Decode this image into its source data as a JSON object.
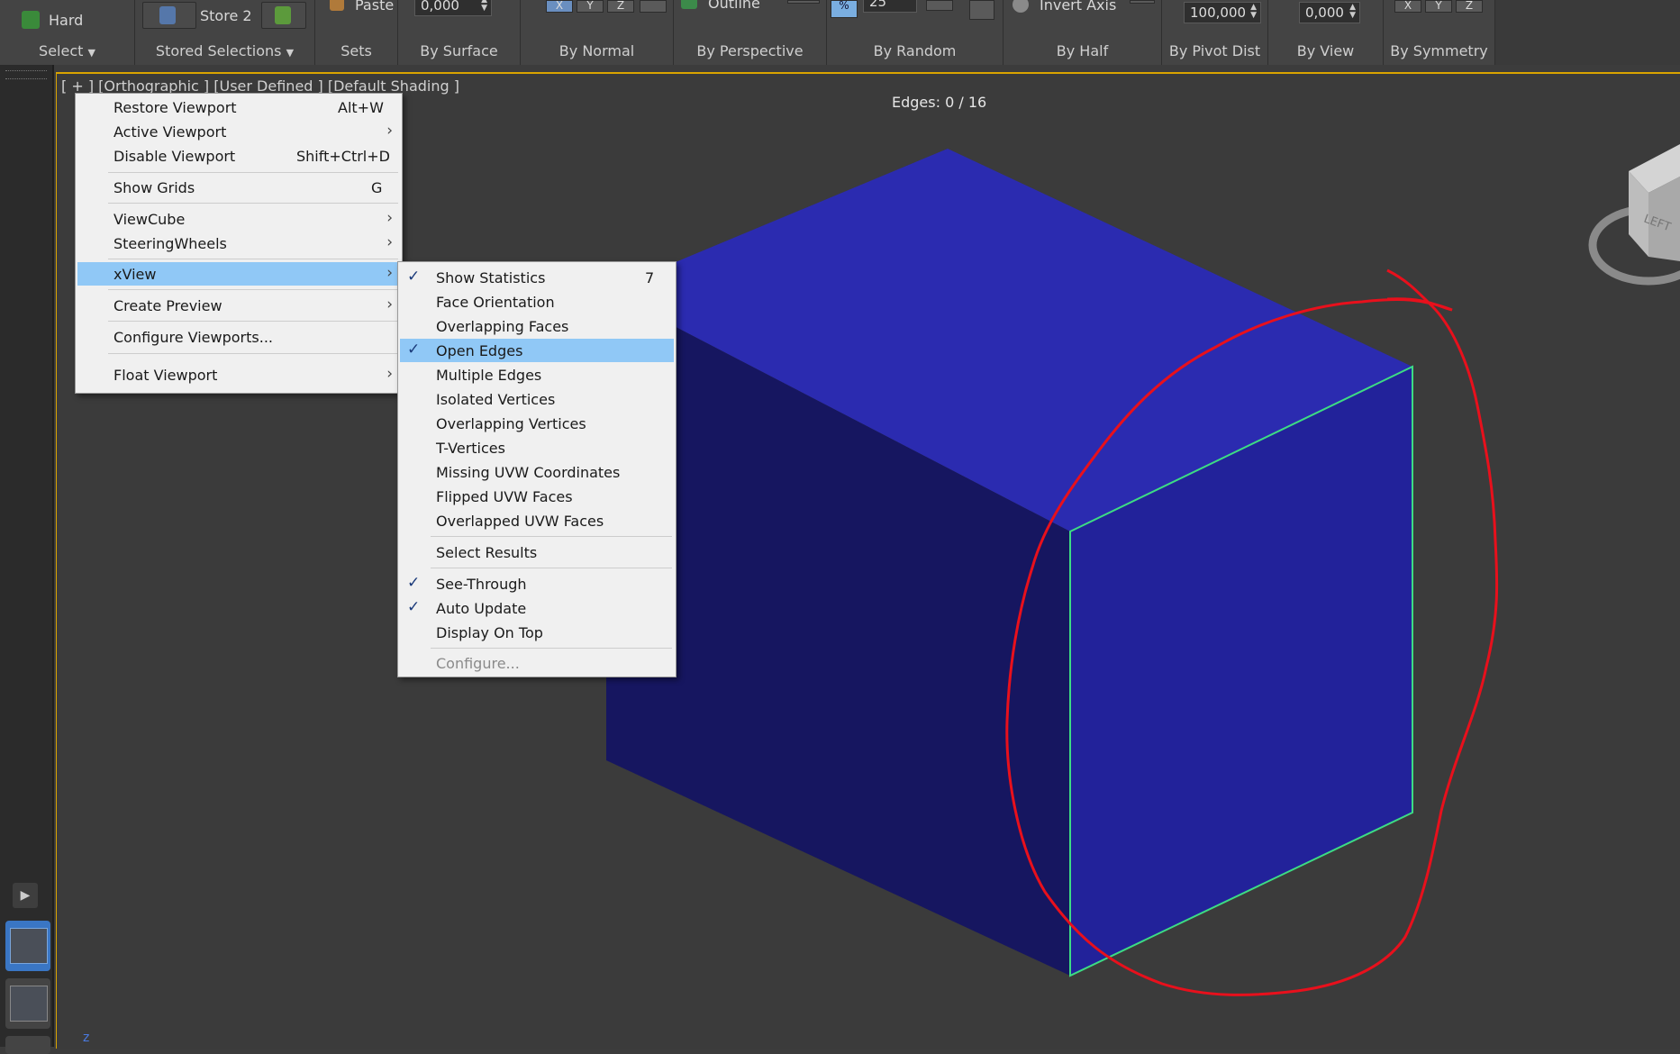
{
  "ribbon": {
    "select_group": {
      "preset": "Hard",
      "label": "Select"
    },
    "stored_group": {
      "store": "Store 2",
      "label": "Stored Selections"
    },
    "sets_group": {
      "paste": "Paste",
      "label": "Sets"
    },
    "surface_group": {
      "value": "0,000",
      "label": "By Surface"
    },
    "normal_group": {
      "label": "By Normal",
      "axes": [
        "X",
        "Y",
        "Z"
      ]
    },
    "perspective_group": {
      "outline": "Outline",
      "label": "By Perspective"
    },
    "random_group": {
      "value": "25",
      "label": "By Random"
    },
    "half_group": {
      "invert_axis": "Invert Axis",
      "label": "By Half"
    },
    "pivot_group": {
      "value": "100,000",
      "label": "By Pivot Dist"
    },
    "view_group": {
      "value": "0,000",
      "label": "By View"
    },
    "symmetry_group": {
      "label": "By Symmetry",
      "axes": [
        "X",
        "Y",
        "Z"
      ]
    }
  },
  "viewport": {
    "label": "[ + ] [Orthographic ] [User Defined ] [Default Shading ]",
    "edges_stat": "Edges: 0 / 16",
    "viewcube_face": "LEFT",
    "axis_label": "z",
    "face_colors": {
      "top": "#2b2bb0",
      "left": "#161660",
      "front": "#22229a",
      "open_edge": "#3ddc84"
    },
    "annotation_color": "#e8101c"
  },
  "context_menu": {
    "items": [
      {
        "label": "Restore Viewport",
        "shortcut": "Alt+W"
      },
      {
        "label": "Active Viewport",
        "submenu": true
      },
      {
        "label": "Disable Viewport",
        "shortcut": "Shift+Ctrl+D"
      },
      {
        "label": "Show Grids",
        "shortcut": "G"
      },
      {
        "label": "ViewCube",
        "submenu": true
      },
      {
        "label": "SteeringWheels",
        "submenu": true
      },
      {
        "label": "xView",
        "submenu": true,
        "highlighted": true
      },
      {
        "label": "Create Preview",
        "submenu": true
      },
      {
        "label": "Configure Viewports..."
      },
      {
        "label": "Float Viewport",
        "submenu": true
      }
    ]
  },
  "xview_menu": {
    "items": [
      {
        "label": "Show Statistics",
        "checked": true,
        "shortcut": "7"
      },
      {
        "label": "Face Orientation"
      },
      {
        "label": "Overlapping Faces"
      },
      {
        "label": "Open Edges",
        "checked": true,
        "highlighted": true
      },
      {
        "label": "Multiple Edges"
      },
      {
        "label": "Isolated Vertices"
      },
      {
        "label": "Overlapping Vertices"
      },
      {
        "label": "T-Vertices"
      },
      {
        "label": "Missing UVW Coordinates"
      },
      {
        "label": "Flipped UVW Faces"
      },
      {
        "label": "Overlapped UVW Faces"
      },
      {
        "label": "Select Results"
      },
      {
        "label": "See-Through",
        "checked": true
      },
      {
        "label": "Auto Update",
        "checked": true
      },
      {
        "label": "Display On Top"
      },
      {
        "label": "Configure...",
        "disabled": true
      }
    ]
  },
  "icons": {
    "check": "✓",
    "submenu": "›",
    "spinner": "▲▼",
    "dropdown": "▼",
    "play": "▶"
  }
}
